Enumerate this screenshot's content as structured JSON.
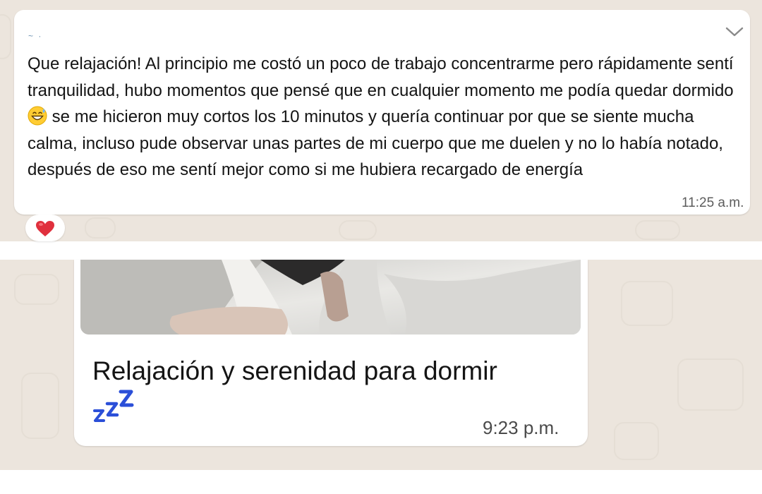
{
  "message1": {
    "sender": "~ ·",
    "text_before_emoji": "Que relajación! Al principio me costó un poco de trabajo concentrarme pero rápidamente sentí tranquilidad, hubo momentos que pensé que en cualquier momento me podía quedar dormido",
    "emoji": "grinning-face-with-sweat",
    "text_after_emoji": "se me hicieron muy cortos los 10 minutos y quería continuar por que se siente mucha calma, incluso pude observar unas partes de mi cuerpo que me duelen y no lo había notado, después de eso me sentí mejor como si me hubiera recargado de energía",
    "time": "11:25 a.m.",
    "reaction": "red-heart",
    "menu_icon": "chevron-down-icon"
  },
  "message2": {
    "thumbnail": "media-thumbnail",
    "title": "Relajación y serenidad para dormir",
    "emoji": "zzz",
    "time": "9:23 p.m."
  },
  "colors": {
    "chat_background": "#ece5dd",
    "bubble": "#ffffff",
    "heart": "#e0303d",
    "zzz": "#2b4fd8"
  }
}
